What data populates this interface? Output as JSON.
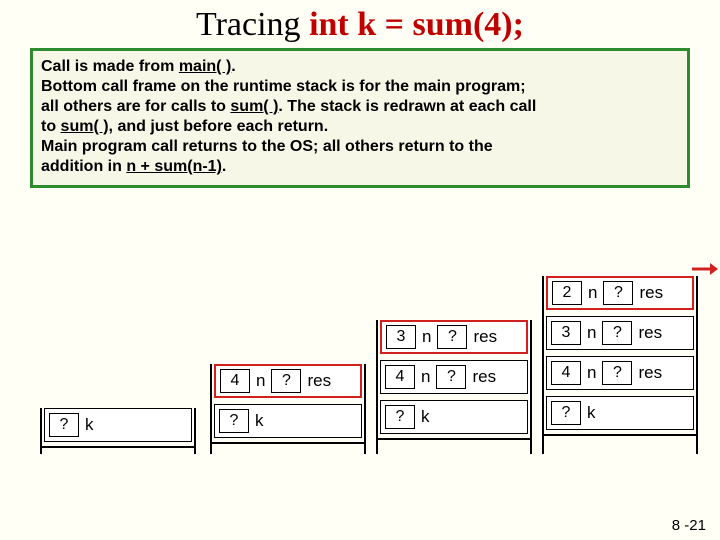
{
  "title": {
    "prefix": "Tracing ",
    "code": "int k = sum(4);"
  },
  "desc": {
    "l1a": "Call is made from ",
    "l1b": "main( )",
    "l1c": ".",
    "l2": "Bottom call frame on the runtime stack is for the main program;",
    "l3a": "all others are for calls to ",
    "l3b": "sum( )",
    "l3c": ". The stack is redrawn at each call",
    "l4a": "to ",
    "l4b": "sum( )",
    "l4c": ", and just before each return.",
    "l5": "Main program call returns to the OS; all others return to the",
    "l6a": "addition in ",
    "l6b": "n + sum(n-1)",
    "l6c": "."
  },
  "labels": {
    "n": "n",
    "res": "res",
    "k": "k",
    "q": "?"
  },
  "vals": {
    "two": "2",
    "three": "3",
    "four": "4"
  },
  "pagenum": "8 -21"
}
